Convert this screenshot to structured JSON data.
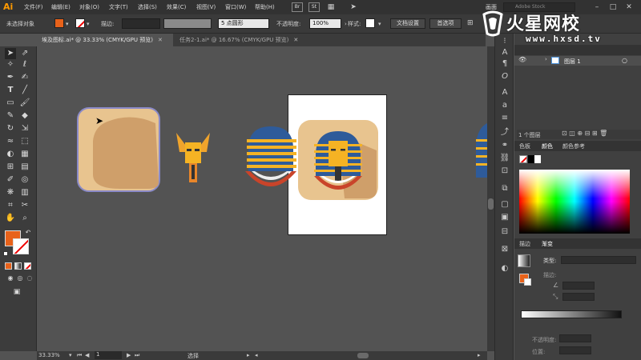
{
  "app": {
    "logo": "Ai",
    "menus": [
      "文件(F)",
      "编辑(E)",
      "对象(O)",
      "文字(T)",
      "选择(S)",
      "效果(C)",
      "视图(V)",
      "窗口(W)",
      "帮助(H)"
    ],
    "bridge": "Br",
    "stock": "St",
    "workspace": "画面",
    "stock_search": "Adobe Stock"
  },
  "controlbar": {
    "selection_status": "未选择对象",
    "stroke_label": "描边:",
    "brush_value": "5 点圆形",
    "opacity_label": "不透明度:",
    "opacity_value": "100%",
    "style_label": "样式:",
    "doc_setup": "文档设置",
    "preferences": "首选项"
  },
  "tabs": [
    {
      "label": "埃及图标.ai* @ 33.33% (CMYK/GPU 预览)",
      "active": true
    },
    {
      "label": "任务2-1.ai* @ 16.67% (CMYK/GPU 预览)",
      "active": false
    }
  ],
  "status": {
    "zoom": "33.33%",
    "page": "1",
    "tool": "选择"
  },
  "layers": {
    "layer_name": "图层 1",
    "count": "1 个图层"
  },
  "color_panel": {
    "tabs": [
      "色板",
      "颜色",
      "颜色参考"
    ],
    "active": "颜色"
  },
  "gradient_panel": {
    "tabs": [
      "描边",
      "渐变"
    ],
    "type_label": "类型:",
    "stroke_label": "描边:",
    "opacity_label": "不透明度:",
    "position_label": "位置:"
  },
  "watermark": {
    "name": "火星网校",
    "url": "www.hxsd.tv"
  },
  "colors": {
    "fill": "#e8621a",
    "accent_blue": "#4a90d9",
    "pharaoh_yellow": "#f5b324",
    "pharaoh_blue": "#2e5b9a",
    "pharaoh_red": "#c9442a",
    "icon_bg": "#d9ad7b"
  }
}
